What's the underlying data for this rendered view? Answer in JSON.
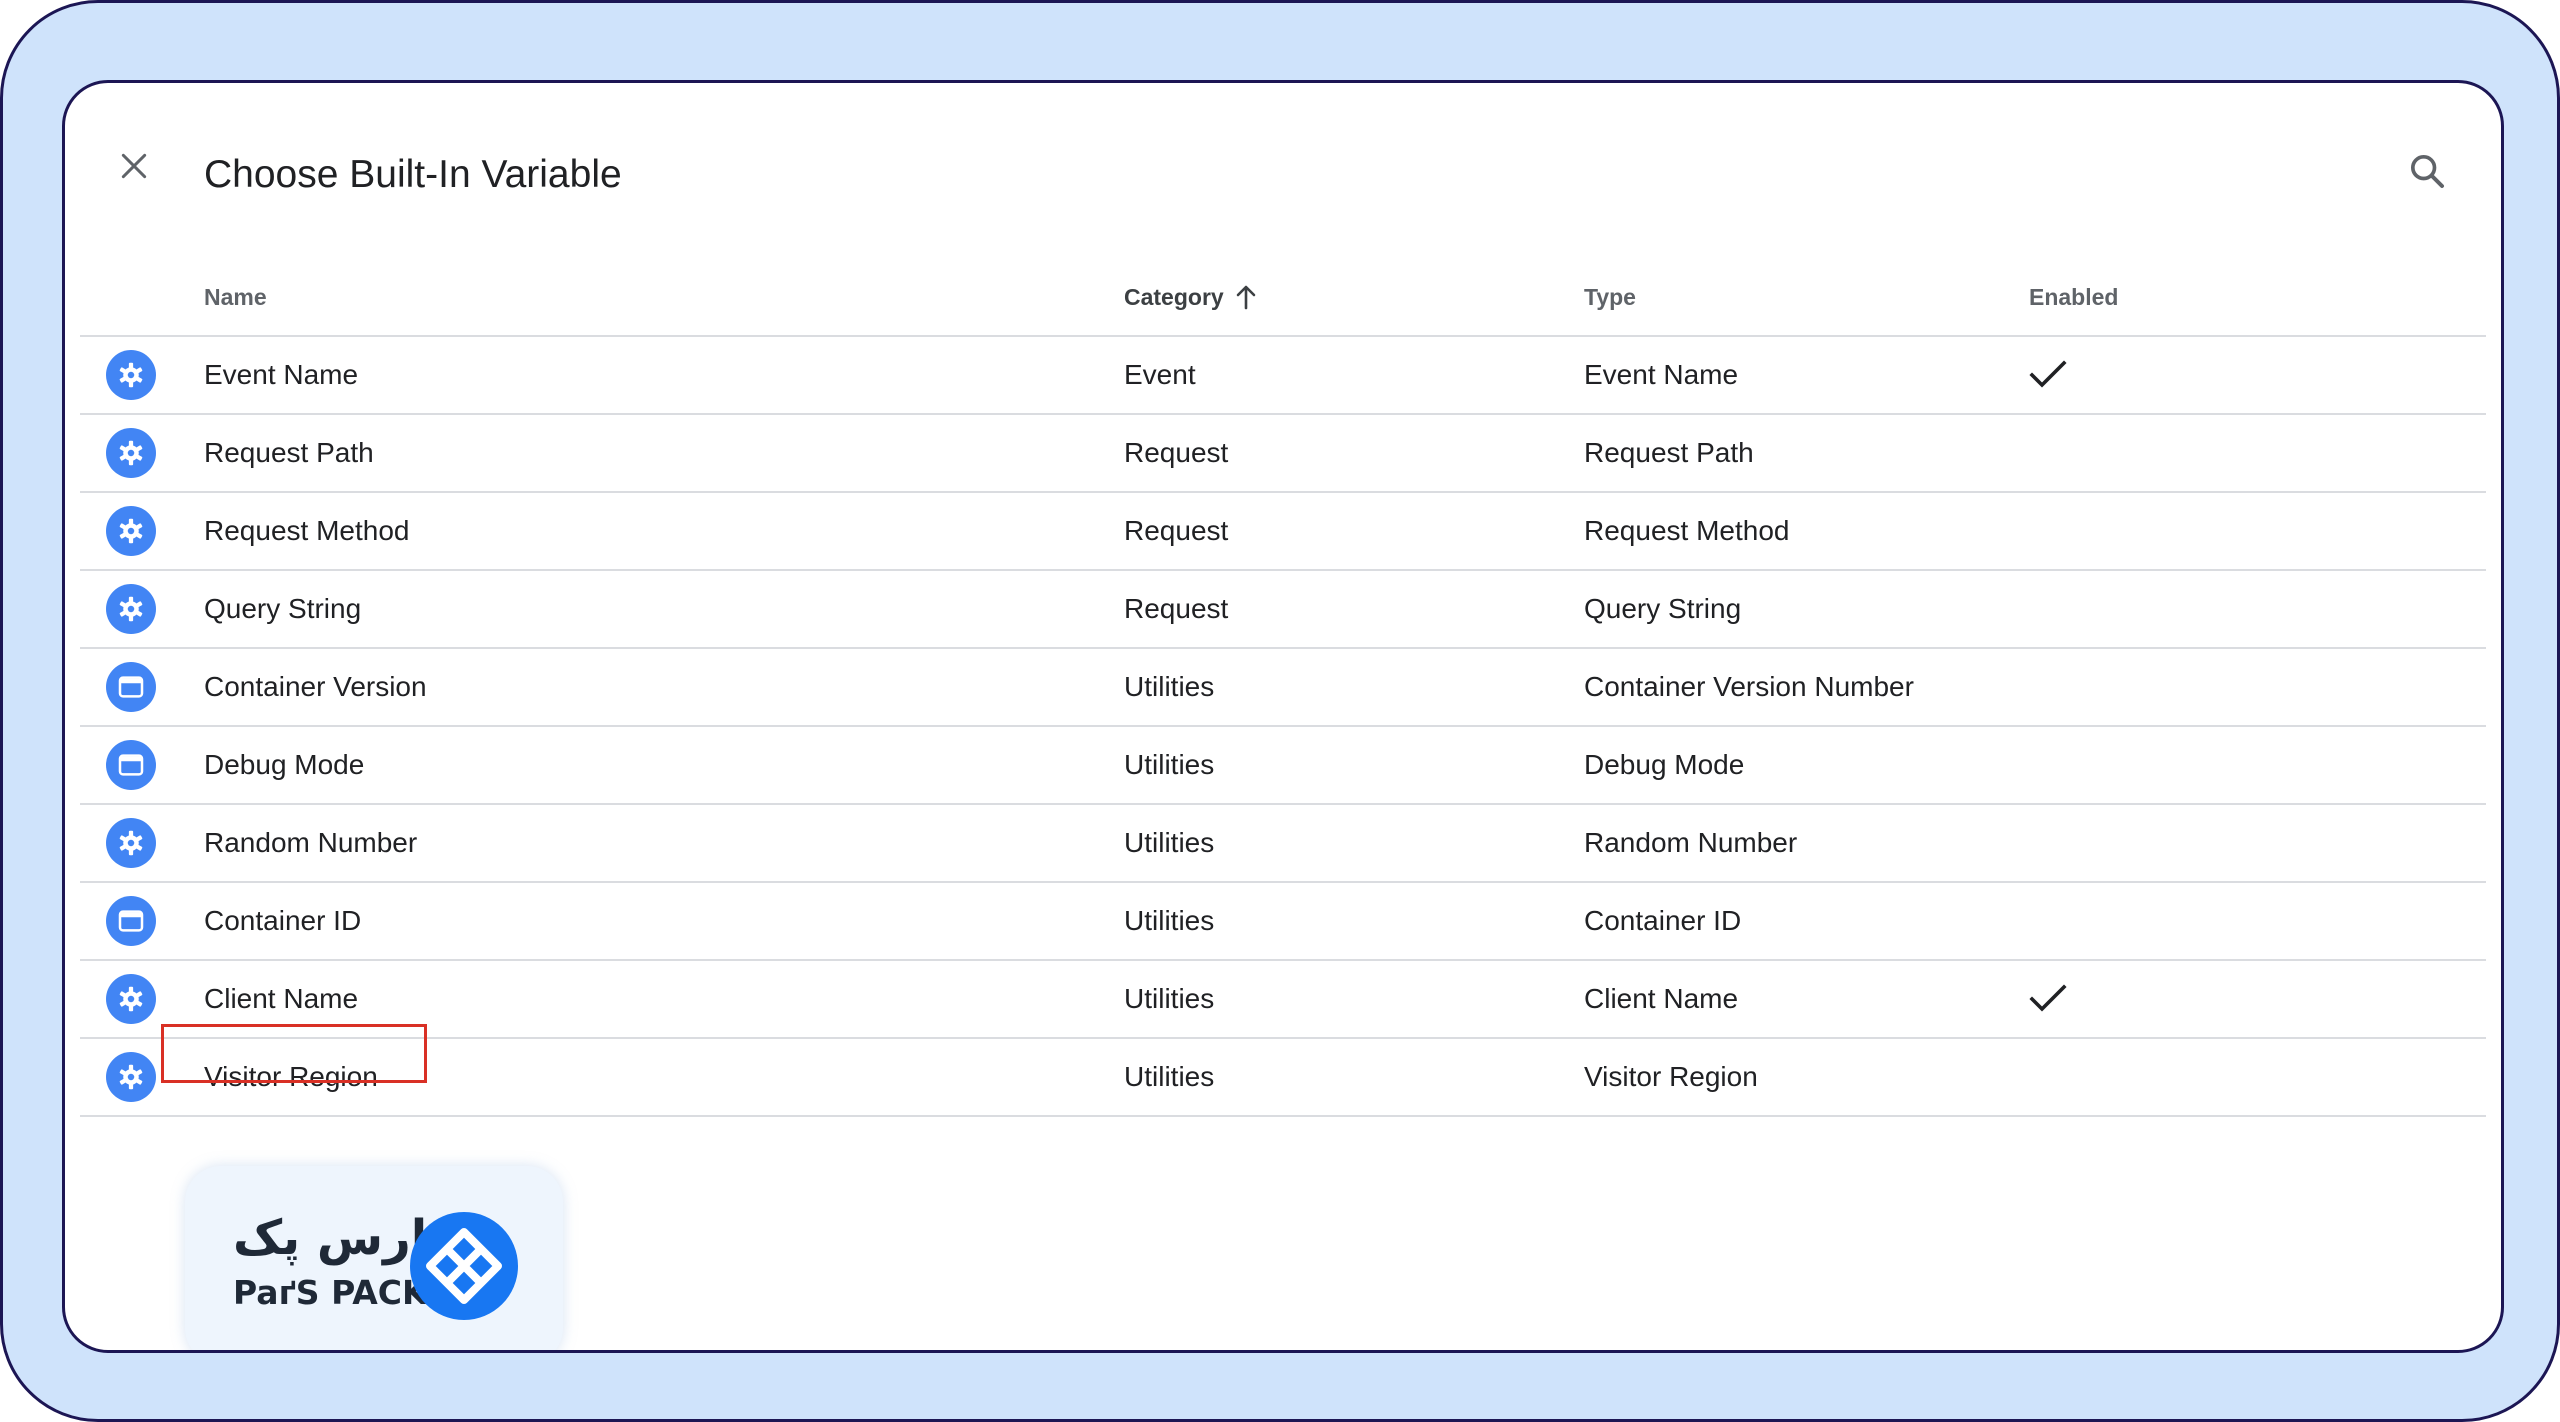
{
  "colors": {
    "frame_bg": "#cfe3fb",
    "frame_border": "#1c1654",
    "icon_blue": "#4285f4",
    "highlight_red": "#d93025",
    "divider": "#dadce0"
  },
  "dialog": {
    "title": "Choose Built-In Variable",
    "close_icon": "close-icon",
    "search_icon": "search-icon"
  },
  "table": {
    "columns": {
      "name": "Name",
      "category": "Category",
      "category_sort": "ascending",
      "type": "Type",
      "enabled": "Enabled"
    },
    "rows": [
      {
        "icon": "gear-icon",
        "name": "Event Name",
        "category": "Event",
        "type": "Event Name",
        "enabled": true
      },
      {
        "icon": "gear-icon",
        "name": "Request Path",
        "category": "Request",
        "type": "Request Path",
        "enabled": false
      },
      {
        "icon": "gear-icon",
        "name": "Request Method",
        "category": "Request",
        "type": "Request Method",
        "enabled": false
      },
      {
        "icon": "gear-icon",
        "name": "Query String",
        "category": "Request",
        "type": "Query String",
        "enabled": false
      },
      {
        "icon": "browser-window-icon",
        "name": "Container Version",
        "category": "Utilities",
        "type": "Container Version Number",
        "enabled": false
      },
      {
        "icon": "browser-window-icon",
        "name": "Debug Mode",
        "category": "Utilities",
        "type": "Debug Mode",
        "enabled": false
      },
      {
        "icon": "gear-icon",
        "name": "Random Number",
        "category": "Utilities",
        "type": "Random Number",
        "enabled": false
      },
      {
        "icon": "browser-window-icon",
        "name": "Container ID",
        "category": "Utilities",
        "type": "Container ID",
        "enabled": false
      },
      {
        "icon": "gear-icon",
        "name": "Client Name",
        "category": "Utilities",
        "type": "Client Name",
        "enabled": true,
        "highlighted": true
      },
      {
        "icon": "gear-icon",
        "name": "Visitor Region",
        "category": "Utilities",
        "type": "Visitor Region",
        "enabled": false
      }
    ]
  },
  "watermark": {
    "text_fa": "پارس پک",
    "text_en": "PaґS PACK",
    "icon": "parspack-diamond-logo-icon"
  }
}
